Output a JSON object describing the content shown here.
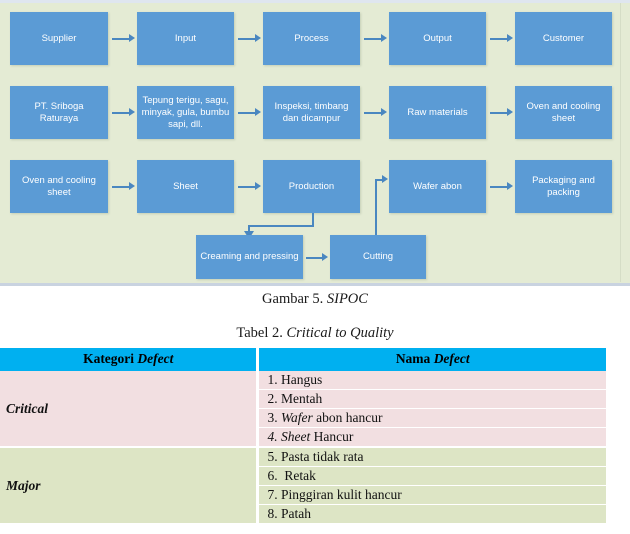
{
  "figure": {
    "caption_prefix": "Gambar 5. ",
    "caption_title": "SIPOC",
    "background_color": "#e4ebd4",
    "box_color": "#5b9bd5",
    "arrow_color": "#4a87c0",
    "rows": [
      {
        "name": "sipoc-header-row",
        "boxes": [
          "Supplier",
          "Input",
          "Process",
          "Output",
          "Customer"
        ]
      },
      {
        "name": "sipoc-detail-row",
        "boxes": [
          "PT. Sriboga Raturaya",
          "Tepung terigu, sagu, minyak, gula, bumbu sapi, dll.",
          "Inspeksi, timbang dan dicampur",
          "Raw materials",
          "Oven and cooling sheet"
        ]
      },
      {
        "name": "sipoc-process-row",
        "boxes": [
          "Oven and cooling sheet",
          "Sheet",
          "Production",
          "Wafer abon",
          "Packaging and packing"
        ]
      },
      {
        "name": "sipoc-subprocess-row",
        "boxes": [
          "Creaming and pressing",
          "Cutting"
        ]
      }
    ]
  },
  "table": {
    "caption_prefix": "Tabel 2. ",
    "caption_title": "Critical to Quality",
    "header_color": "#00b0f0",
    "critical_row_color": "#f2dfe1",
    "major_row_color": "#dde5c5",
    "headers": {
      "kategori_prefix": "Kategori ",
      "kategori_italic": "Defect",
      "nama_prefix": "Nama ",
      "nama_italic": "Defect"
    },
    "groups": [
      {
        "category": "Critical",
        "defects": [
          {
            "num": "1. ",
            "italic": "",
            "text": "Hangus",
            "num_italic": false
          },
          {
            "num": "2. ",
            "italic": "",
            "text": "Mentah",
            "num_italic": false
          },
          {
            "num": "3. ",
            "italic": "Wafer",
            "text": " abon hancur",
            "num_italic": false
          },
          {
            "num": "4. ",
            "italic": "Sheet",
            "text": " Hancur",
            "num_italic": true
          }
        ]
      },
      {
        "category": "Major",
        "defects": [
          {
            "num": "5. ",
            "italic": "",
            "text": "Pasta tidak rata",
            "num_italic": false
          },
          {
            "num": "6.  ",
            "italic": "",
            "text": "Retak",
            "num_italic": false
          },
          {
            "num": "7. ",
            "italic": "",
            "text": "Pinggiran kulit hancur",
            "num_italic": false
          },
          {
            "num": "8. ",
            "italic": "",
            "text": "Patah",
            "num_italic": false
          }
        ]
      }
    ]
  }
}
